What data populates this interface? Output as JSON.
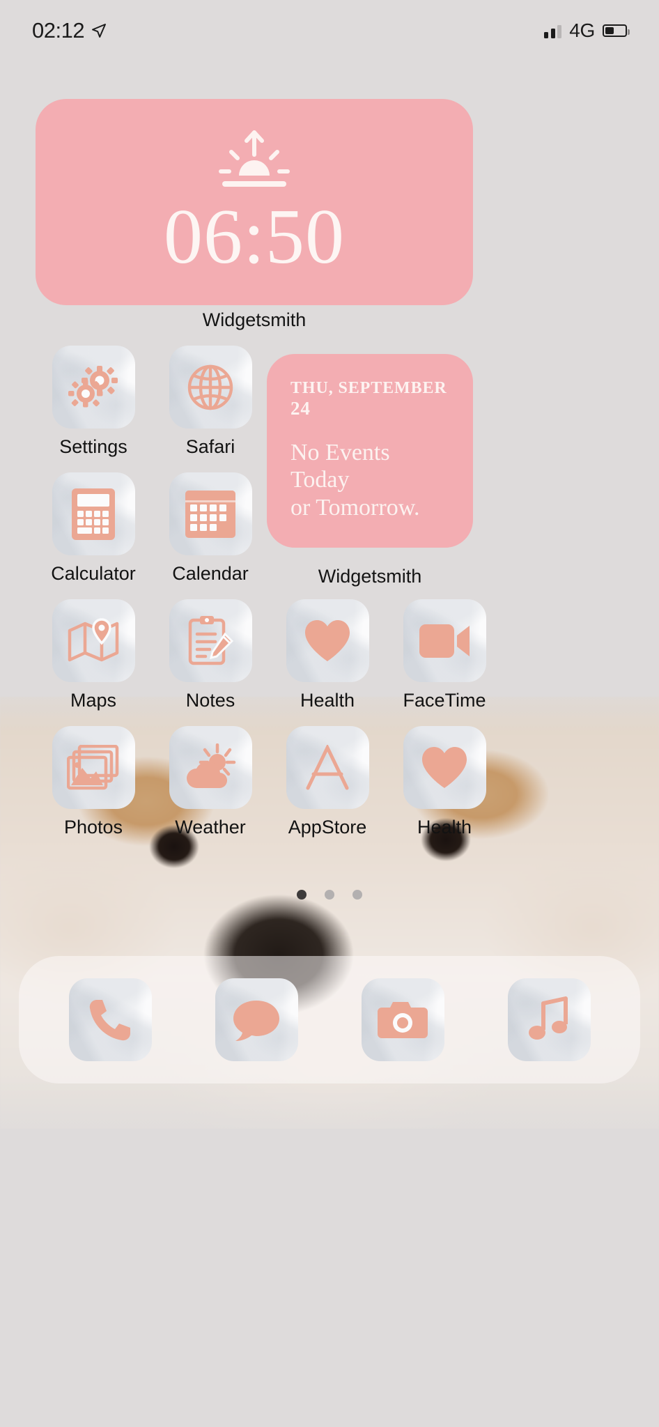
{
  "status_bar": {
    "time": "02:12",
    "location_icon": "location-arrow-icon",
    "network": "4G",
    "signal_icon": "cellular-signal-icon",
    "battery_icon": "battery-icon"
  },
  "colors": {
    "widget_pink": "#f3adb2",
    "icon_glyph": "#eba793",
    "background": "#dedbdb",
    "label_text": "#121212"
  },
  "clock_widget": {
    "icon": "sunrise-icon",
    "time": "06:50",
    "label": "Widgetsmith"
  },
  "calendar_widget": {
    "date_prefix": "THU, SEPTEMBER ",
    "date_day": "24",
    "message_line1": "No Events Today",
    "message_line2": "or Tomorrow.",
    "label": "Widgetsmith"
  },
  "apps": {
    "row1": [
      {
        "label": "Settings",
        "icon": "gears-icon"
      },
      {
        "label": "Safari",
        "icon": "globe-icon"
      }
    ],
    "row2": [
      {
        "label": "Calculator",
        "icon": "calculator-icon"
      },
      {
        "label": "Calendar",
        "icon": "calendar-grid-icon"
      }
    ],
    "row3": [
      {
        "label": "Maps",
        "icon": "map-pin-icon"
      },
      {
        "label": "Notes",
        "icon": "clipboard-pencil-icon"
      },
      {
        "label": "Health",
        "icon": "heart-icon"
      },
      {
        "label": "FaceTime",
        "icon": "video-camera-icon"
      }
    ],
    "row4": [
      {
        "label": "Photos",
        "icon": "photos-stack-icon"
      },
      {
        "label": "Weather",
        "icon": "sun-cloud-icon"
      },
      {
        "label": "AppStore",
        "icon": "app-store-a-icon"
      },
      {
        "label": "Health",
        "icon": "heart-icon"
      }
    ]
  },
  "page_dots": {
    "total": 3,
    "active_index": 0
  },
  "dock": [
    {
      "icon": "phone-icon"
    },
    {
      "icon": "message-bubble-icon"
    },
    {
      "icon": "camera-icon"
    },
    {
      "icon": "music-note-icon"
    }
  ]
}
